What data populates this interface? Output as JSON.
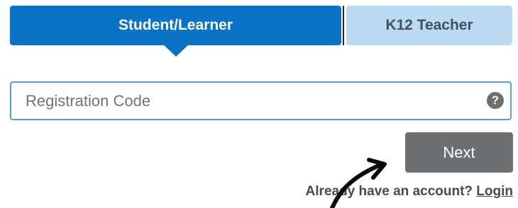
{
  "tabs": {
    "student_label": "Student/Learner",
    "teacher_label": "K12 Teacher",
    "active": "Student/Learner"
  },
  "registration": {
    "placeholder": "Registration Code",
    "value": "",
    "help_icon": "question-circle-icon",
    "help_glyph": "?"
  },
  "actions": {
    "next_label": "Next"
  },
  "footer": {
    "prompt": "Already have an account?",
    "login_label": "Login"
  },
  "icons": {
    "annotation": "hand-drawn-arrow-icon"
  },
  "colors": {
    "active_tab": "#0a73c7",
    "inactive_tab": "#bcd9f2",
    "input_border": "#5b9bcf",
    "next_button": "#6d7072"
  }
}
